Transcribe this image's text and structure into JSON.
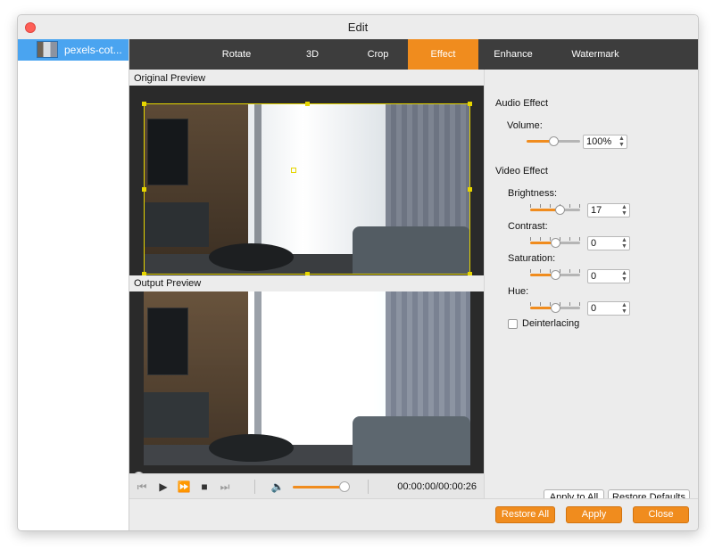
{
  "window": {
    "title": "Edit"
  },
  "sidebar": {
    "file_name": "pexels-cot..."
  },
  "tabs": [
    {
      "label": "Rotate",
      "active": false
    },
    {
      "label": "3D",
      "active": false
    },
    {
      "label": "Crop",
      "active": false
    },
    {
      "label": "Effect",
      "active": true
    },
    {
      "label": "Enhance",
      "active": false
    },
    {
      "label": "Watermark",
      "active": false
    }
  ],
  "preview": {
    "original_label": "Original Preview",
    "output_label": "Output Preview",
    "playback_progress": 0.0
  },
  "player": {
    "icons": [
      "skip-back-icon",
      "play-icon",
      "fast-forward-icon",
      "stop-icon",
      "skip-forward-icon",
      "volume-icon"
    ],
    "volume_level": 0.85,
    "timecode": "00:00:00/00:00:26"
  },
  "audio_effect": {
    "header": "Audio Effect",
    "volume_label": "Volume:",
    "volume_value": "100%",
    "volume_slider_level": 0.5
  },
  "video_effect": {
    "header": "Video Effect",
    "brightness_label": "Brightness:",
    "brightness_value": "17",
    "contrast_label": "Contrast:",
    "contrast_value": "0",
    "saturation_label": "Saturation:",
    "saturation_value": "0",
    "hue_label": "Hue:",
    "hue_value": "0",
    "deinterlacing_label": "Deinterlacing",
    "deinterlacing_checked": false
  },
  "buttons": {
    "apply_to_all": "Apply to All",
    "restore_defaults": "Restore Defaults",
    "restore_all": "Restore All",
    "apply": "Apply",
    "close": "Close"
  },
  "colors": {
    "accent": "#f08c1e",
    "selection": "#4aa4f0",
    "tabbar": "#3d3d3d"
  }
}
